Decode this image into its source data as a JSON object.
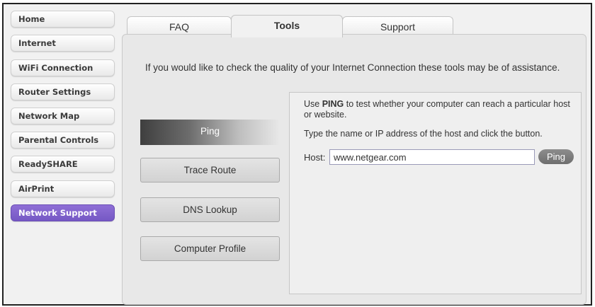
{
  "sidebar": {
    "items": [
      {
        "label": "Home"
      },
      {
        "label": "Internet"
      },
      {
        "label": "WiFi Connection"
      },
      {
        "label": "Router Settings"
      },
      {
        "label": "Network Map"
      },
      {
        "label": "Parental Controls"
      },
      {
        "label": "ReadySHARE"
      },
      {
        "label": "AirPrint"
      },
      {
        "label": "Network Support",
        "active": true
      }
    ]
  },
  "tabs": [
    {
      "label": "FAQ"
    },
    {
      "label": "Tools",
      "active": true
    },
    {
      "label": "Support"
    }
  ],
  "main": {
    "intro": "If you would like to check the quality of your Internet Connection these tools may be of assistance.",
    "tools": [
      {
        "label": "Ping",
        "selected": true
      },
      {
        "label": "Trace Route"
      },
      {
        "label": "DNS Lookup"
      },
      {
        "label": "Computer Profile"
      }
    ],
    "ping_panel": {
      "desc_prefix": "Use ",
      "desc_bold": "PING",
      "desc_rest": " to test whether your computer can reach a particular host or website.",
      "instruction": "Type the name or IP address of the host and click the button.",
      "host_label": "Host:",
      "host_value": "www.netgear.com",
      "button_label": "Ping"
    }
  },
  "colors": {
    "active_nav": "#7d5fcb",
    "frame": "#222222"
  }
}
